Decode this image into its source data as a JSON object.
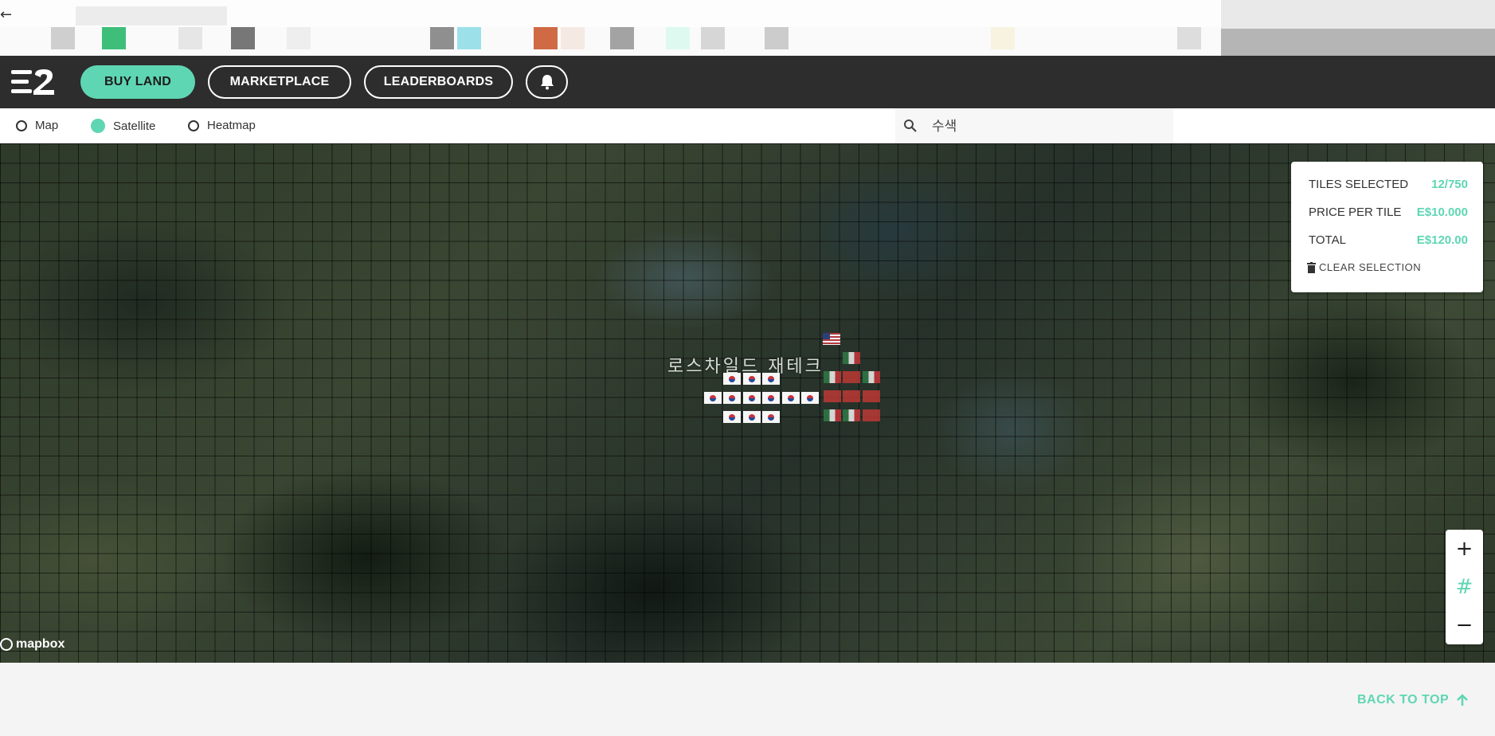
{
  "browser": {
    "back_icon": "arrow-left-icon",
    "bookmark_colors": [
      "#cfcfcf",
      "#3fbe7a",
      "#e6e6e6",
      "#777777",
      "#eeeeee",
      "#8f8f8f",
      "#9ce1ea",
      "#cf6a45",
      "#f5e9e3",
      "#a3a3a3",
      "#defaf0",
      "#d6d6d6",
      "#cccccc",
      "#f8f3e0",
      "#dddddd"
    ]
  },
  "nav": {
    "logo_label": "E2",
    "buy_land": "BUY LAND",
    "marketplace": "MARKETPLACE",
    "leaderboards": "LEADERBOARDS",
    "bell_icon": "bell-icon"
  },
  "modes": {
    "map": "Map",
    "satellite": "Satellite",
    "heatmap": "Heatmap",
    "selected": "Satellite"
  },
  "search": {
    "placeholder": "수색",
    "value": ""
  },
  "map": {
    "place_label": "로스차일드 재테크",
    "attribution": "mapbox"
  },
  "selection_panel": {
    "tiles_selected_label": "TILES SELECTED",
    "tiles_selected_value": "12/750",
    "price_per_tile_label": "PRICE PER TILE",
    "price_per_tile_value": "E$10.000",
    "total_label": "TOTAL",
    "total_value": "E$120.00",
    "clear_selection": "CLEAR SELECTION"
  },
  "zoom": {
    "zoom_in": "+",
    "grid_toggle": "#",
    "zoom_out": "−"
  },
  "footer": {
    "back_to_top": "BACK TO TOP"
  },
  "colors": {
    "accent": "#5fd6b3",
    "navbar": "#2d2d2d"
  }
}
